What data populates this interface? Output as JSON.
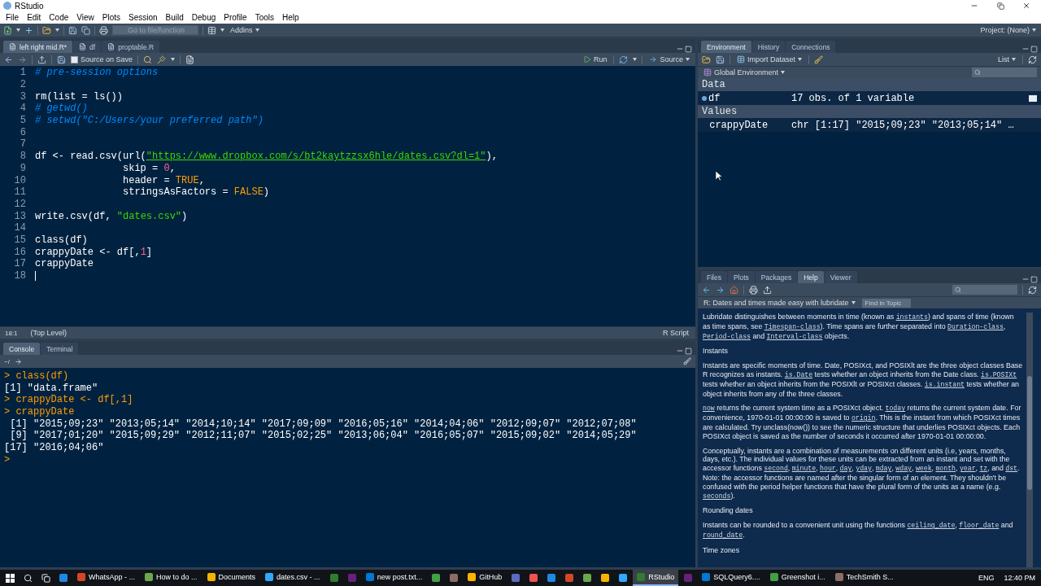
{
  "window": {
    "title": "RStudio"
  },
  "menu": [
    "File",
    "Edit",
    "Code",
    "View",
    "Plots",
    "Session",
    "Build",
    "Debug",
    "Profile",
    "Tools",
    "Help"
  ],
  "toolbar": {
    "goto_placeholder": "Go to file/function",
    "addins": "Addins",
    "project": "Project: (None)"
  },
  "editor": {
    "tabs": [
      {
        "label": "left right mid.R*",
        "selected": true
      },
      {
        "label": "df",
        "selected": false
      },
      {
        "label": "proptable.R",
        "selected": false
      }
    ],
    "source_on_save": {
      "label": "Source on Save",
      "checked": false
    },
    "run": "Run",
    "source": "Source",
    "lines": [
      {
        "number": "1",
        "cursor": false,
        "tokens": [
          {
            "kind": "comment",
            "text": "# pre-session options"
          }
        ]
      },
      {
        "number": "2",
        "cursor": false
      },
      {
        "number": "3",
        "cursor": false,
        "tokens": [
          {
            "kind": "plain",
            "text": "rm(list = ls())"
          }
        ]
      },
      {
        "number": "4",
        "cursor": false,
        "tokens": [
          {
            "kind": "comment",
            "text": "# getwd()"
          }
        ]
      },
      {
        "number": "5",
        "cursor": false,
        "tokens": [
          {
            "kind": "comment",
            "text": "# setwd(\"C:/Users/your preferred path\")"
          }
        ]
      },
      {
        "number": "6",
        "cursor": false
      },
      {
        "number": "7",
        "cursor": false
      },
      {
        "number": "8",
        "cursor": false,
        "tokens": [
          {
            "kind": "plain",
            "text": "df <- read.csv(url("
          },
          {
            "kind": "url",
            "text": "\"https://www.dropbox.com/s/bt2kaytzzsx6hle/dates.csv?dl=1\""
          },
          {
            "kind": "plain",
            "text": "),"
          }
        ]
      },
      {
        "number": "9",
        "cursor": false,
        "tokens": [
          {
            "kind": "plain",
            "text": "               skip = "
          },
          {
            "kind": "number",
            "text": "0"
          },
          {
            "kind": "plain",
            "text": ","
          }
        ]
      },
      {
        "number": "10",
        "cursor": false,
        "tokens": [
          {
            "kind": "plain",
            "text": "               header = "
          },
          {
            "kind": "keyword",
            "text": "TRUE"
          },
          {
            "kind": "plain",
            "text": ","
          }
        ]
      },
      {
        "number": "11",
        "cursor": false,
        "tokens": [
          {
            "kind": "plain",
            "text": "               stringsAsFactors = "
          },
          {
            "kind": "keyword",
            "text": "FALSE"
          },
          {
            "kind": "plain",
            "text": ")"
          }
        ]
      },
      {
        "number": "12",
        "cursor": false
      },
      {
        "number": "13",
        "cursor": false,
        "tokens": [
          {
            "kind": "plain",
            "text": "write.csv(df, "
          },
          {
            "kind": "string",
            "text": "\"dates.csv\""
          },
          {
            "kind": "plain",
            "text": ")"
          }
        ]
      },
      {
        "number": "14",
        "cursor": false
      },
      {
        "number": "15",
        "cursor": false,
        "tokens": [
          {
            "kind": "plain",
            "text": "class(df)"
          }
        ]
      },
      {
        "number": "16",
        "cursor": false,
        "tokens": [
          {
            "kind": "plain",
            "text": "crappyDate <- df[,"
          },
          {
            "kind": "number",
            "text": "1"
          },
          {
            "kind": "plain",
            "text": "]"
          }
        ]
      },
      {
        "number": "17",
        "cursor": false,
        "tokens": [
          {
            "kind": "plain",
            "text": "crappyDate"
          }
        ]
      },
      {
        "number": "18",
        "cursor": true
      }
    ],
    "status": {
      "position": "18:1",
      "scope": "(Top Level)",
      "file_type": "R Script"
    }
  },
  "console": {
    "tabs": [
      {
        "label": "Console",
        "selected": true
      },
      {
        "label": "Terminal",
        "selected": false
      }
    ],
    "path": "~/",
    "lines": [
      {
        "kind": "input",
        "text": "> class(df)"
      },
      {
        "kind": "output",
        "text": "[1] \"data.frame\""
      },
      {
        "kind": "input",
        "text": "> crappyDate <- df[,1]"
      },
      {
        "kind": "input",
        "text": "> crappyDate"
      },
      {
        "kind": "output",
        "text": " [1] \"2015;09;23\" \"2013;05;14\" \"2014;10;14\" \"2017;09;09\" \"2016;05;16\" \"2014;04;06\" \"2012;09;07\" \"2012;07;08\""
      },
      {
        "kind": "output",
        "text": " [9] \"2017;01;20\" \"2015;09;29\" \"2012;11;07\" \"2015;02;25\" \"2013;06;04\" \"2016;05;07\" \"2015;09;02\" \"2014;05;29\""
      },
      {
        "kind": "output",
        "text": "[17] \"2016;04;06\""
      },
      {
        "kind": "prompt",
        "text": ">"
      }
    ]
  },
  "environment": {
    "tabs": [
      {
        "label": "Environment",
        "selected": true
      },
      {
        "label": "History",
        "selected": false
      },
      {
        "label": "Connections",
        "selected": false
      }
    ],
    "import": "Import Dataset",
    "view": "List",
    "scope": "Global Environment",
    "sections": [
      {
        "title": "Data",
        "rows": [
          {
            "kind": "data",
            "name": "df",
            "value": "17 obs. of 1 variable"
          }
        ]
      },
      {
        "title": "Values",
        "rows": [
          {
            "kind": "value",
            "name": "crappyDate",
            "value": "chr [1:17] \"2015;09;23\" \"2013;05;14\" …"
          }
        ]
      }
    ]
  },
  "help": {
    "tabs": [
      {
        "label": "Files",
        "selected": false
      },
      {
        "label": "Plots",
        "selected": false
      },
      {
        "label": "Packages",
        "selected": false
      },
      {
        "label": "Help",
        "selected": true
      },
      {
        "label": "Viewer",
        "selected": false
      }
    ],
    "topic": "R: Dates and times made easy with lubridate",
    "find_placeholder": "Find in Topic",
    "blocks": [
      {
        "kind": "paragraph",
        "parts": [
          {
            "text": "Lubridate distinguishes between moments in time (known as ",
            "link": false
          },
          {
            "text": "instants",
            "link": true
          },
          {
            "text": ") and spans of time (known as time spans, see ",
            "link": false
          },
          {
            "text": "Timespan-class",
            "link": true
          },
          {
            "text": "). Time spans are further separated into ",
            "link": false
          },
          {
            "text": "Duration-class",
            "link": true
          },
          {
            "text": ", ",
            "link": false
          },
          {
            "text": "Period-class",
            "link": true
          },
          {
            "text": " and ",
            "link": false
          },
          {
            "text": "Interval-class",
            "link": true
          },
          {
            "text": " objects.",
            "link": false
          }
        ]
      },
      {
        "kind": "heading",
        "text": "Instants"
      },
      {
        "kind": "paragraph",
        "parts": [
          {
            "text": "Instants are specific moments of time. Date, POSIXct, and POSIXlt are the three object classes Base R recognizes as instants. ",
            "link": false
          },
          {
            "text": "is.Date",
            "link": true
          },
          {
            "text": " tests whether an object inherits from the Date class. ",
            "link": false
          },
          {
            "text": "is.POSIXt",
            "link": true
          },
          {
            "text": " tests whether an object inherits from the POSIXlt or POSIXct classes. ",
            "link": false
          },
          {
            "text": "is.instant",
            "link": true
          },
          {
            "text": " tests whether an object inherits from any of the three classes.",
            "link": false
          }
        ]
      },
      {
        "kind": "paragraph",
        "parts": [
          {
            "text": "now",
            "link": true
          },
          {
            "text": " returns the current system time as a POSIXct object. ",
            "link": false
          },
          {
            "text": "today",
            "link": true
          },
          {
            "text": " returns the current system date. For convenience, 1970-01-01 00:00:00 is saved to ",
            "link": false
          },
          {
            "text": "origin",
            "link": true
          },
          {
            "text": ". This is the instant from which POSIXct times are calculated. Try unclass(now()) to see the numeric structure that underlies POSIXct objects. Each POSIXct object is saved as the number of seconds it occurred after 1970-01-01 00:00:00.",
            "link": false
          }
        ]
      },
      {
        "kind": "paragraph",
        "parts": [
          {
            "text": "Conceptually, instants are a combination of measurements on different units (i.e, years, months, days, etc.). The individual values for these units can be extracted from an instant and set with the accessor functions ",
            "link": false
          },
          {
            "text": "second",
            "link": true
          },
          {
            "text": ", ",
            "link": false
          },
          {
            "text": "minute",
            "link": true
          },
          {
            "text": ", ",
            "link": false
          },
          {
            "text": "hour",
            "link": true
          },
          {
            "text": ", ",
            "link": false
          },
          {
            "text": "day",
            "link": true
          },
          {
            "text": ", ",
            "link": false
          },
          {
            "text": "yday",
            "link": true
          },
          {
            "text": ", ",
            "link": false
          },
          {
            "text": "mday",
            "link": true
          },
          {
            "text": ", ",
            "link": false
          },
          {
            "text": "wday",
            "link": true
          },
          {
            "text": ", ",
            "link": false
          },
          {
            "text": "week",
            "link": true
          },
          {
            "text": ", ",
            "link": false
          },
          {
            "text": "month",
            "link": true
          },
          {
            "text": ", ",
            "link": false
          },
          {
            "text": "year",
            "link": true
          },
          {
            "text": ", ",
            "link": false
          },
          {
            "text": "tz",
            "link": true
          },
          {
            "text": ", and ",
            "link": false
          },
          {
            "text": "dst",
            "link": true
          },
          {
            "text": ". Note: the accessor functions are named after the singular form of an element. They shouldn't be confused with the period helper functions that have the plural form of the units as a name (e.g. ",
            "link": false
          },
          {
            "text": "seconds",
            "link": true
          },
          {
            "text": ").",
            "link": false
          }
        ]
      },
      {
        "kind": "heading",
        "text": "Rounding dates"
      },
      {
        "kind": "paragraph",
        "parts": [
          {
            "text": "Instants can be rounded to a convenient unit using the functions ",
            "link": false
          },
          {
            "text": "ceiling_date",
            "link": true
          },
          {
            "text": ", ",
            "link": false
          },
          {
            "text": "floor_date",
            "link": true
          },
          {
            "text": " and ",
            "link": false
          },
          {
            "text": "round_date",
            "link": true
          },
          {
            "text": ".",
            "link": false
          }
        ]
      },
      {
        "kind": "heading",
        "text": "Time zones"
      }
    ]
  },
  "taskbar": {
    "items": [
      {
        "kind": "start",
        "selected": false
      },
      {
        "kind": "search",
        "selected": false
      },
      {
        "kind": "taskview",
        "selected": false
      },
      {
        "kind": "icon",
        "selected": false
      },
      {
        "kind": "app",
        "label": "WhatsApp - ...",
        "selected": false
      },
      {
        "kind": "app",
        "label": "How to do ...",
        "selected": false
      },
      {
        "kind": "app",
        "label": "Documents",
        "selected": false
      },
      {
        "kind": "app",
        "label": "dates.csv - ...",
        "selected": false
      },
      {
        "kind": "icon",
        "selected": false
      },
      {
        "kind": "icon",
        "selected": false
      },
      {
        "kind": "app",
        "label": "new post.txt...",
        "selected": false
      },
      {
        "kind": "icon",
        "selected": false
      },
      {
        "kind": "icon",
        "selected": false
      },
      {
        "kind": "app",
        "label": "GitHub",
        "selected": false
      },
      {
        "kind": "icon",
        "selected": false
      },
      {
        "kind": "icon",
        "selected": false
      },
      {
        "kind": "icon",
        "selected": false
      },
      {
        "kind": "icon",
        "selected": false
      },
      {
        "kind": "icon",
        "selected": false
      },
      {
        "kind": "icon",
        "selected": false
      },
      {
        "kind": "icon",
        "selected": false
      },
      {
        "kind": "app",
        "label": "RStudio",
        "selected": true
      },
      {
        "kind": "icon",
        "selected": false
      },
      {
        "kind": "app",
        "label": "SQLQuery6....",
        "selected": false
      },
      {
        "kind": "app",
        "label": "Greenshot i...",
        "selected": false
      },
      {
        "kind": "app",
        "label": "TechSmith S...",
        "selected": false
      }
    ],
    "language": "ENG",
    "time": "12:40 PM"
  }
}
